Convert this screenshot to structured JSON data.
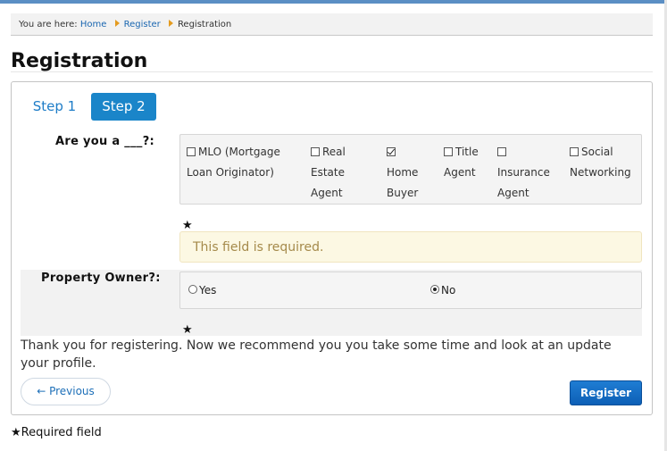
{
  "breadcrumb": {
    "prefix": "You are here:",
    "items": [
      "Home",
      "Register",
      "Registration"
    ]
  },
  "page_title": "Registration",
  "steps": [
    "Step 1",
    "Step 2"
  ],
  "role_question": {
    "label": "Are you a ___?:",
    "options": [
      {
        "line1": "MLO (Mortgage",
        "line2": "Loan Originator)",
        "line3": "",
        "checked": false
      },
      {
        "line1": "Real",
        "line2": "Estate",
        "line3": "Agent",
        "checked": false
      },
      {
        "line1": "",
        "line2": "Home",
        "line3": "Buyer",
        "checked": true
      },
      {
        "line1": "Title",
        "line2": "Agent",
        "line3": "",
        "checked": false
      },
      {
        "line1": "",
        "line2": "Insurance",
        "line3": "Agent",
        "checked": false
      },
      {
        "line1": "Social",
        "line2": "Networking",
        "line3": "",
        "checked": false
      }
    ],
    "required_star": "★",
    "error": "This field is required."
  },
  "property_owner": {
    "label": "Property Owner?:",
    "options": [
      "Yes",
      "No"
    ],
    "selected": "No",
    "required_star": "★"
  },
  "thanks_text": "Thank you for registering. Now we recommend you you take some time and look at an update your profile.",
  "buttons": {
    "previous": "← Previous",
    "register": "Register"
  },
  "required_note": {
    "star": "★",
    "text": "Required field"
  },
  "colors": {
    "accent": "#1a85c9",
    "link": "#1a66b0",
    "warning_bg": "#fcf8e3",
    "warning_text": "#a58a4b"
  }
}
